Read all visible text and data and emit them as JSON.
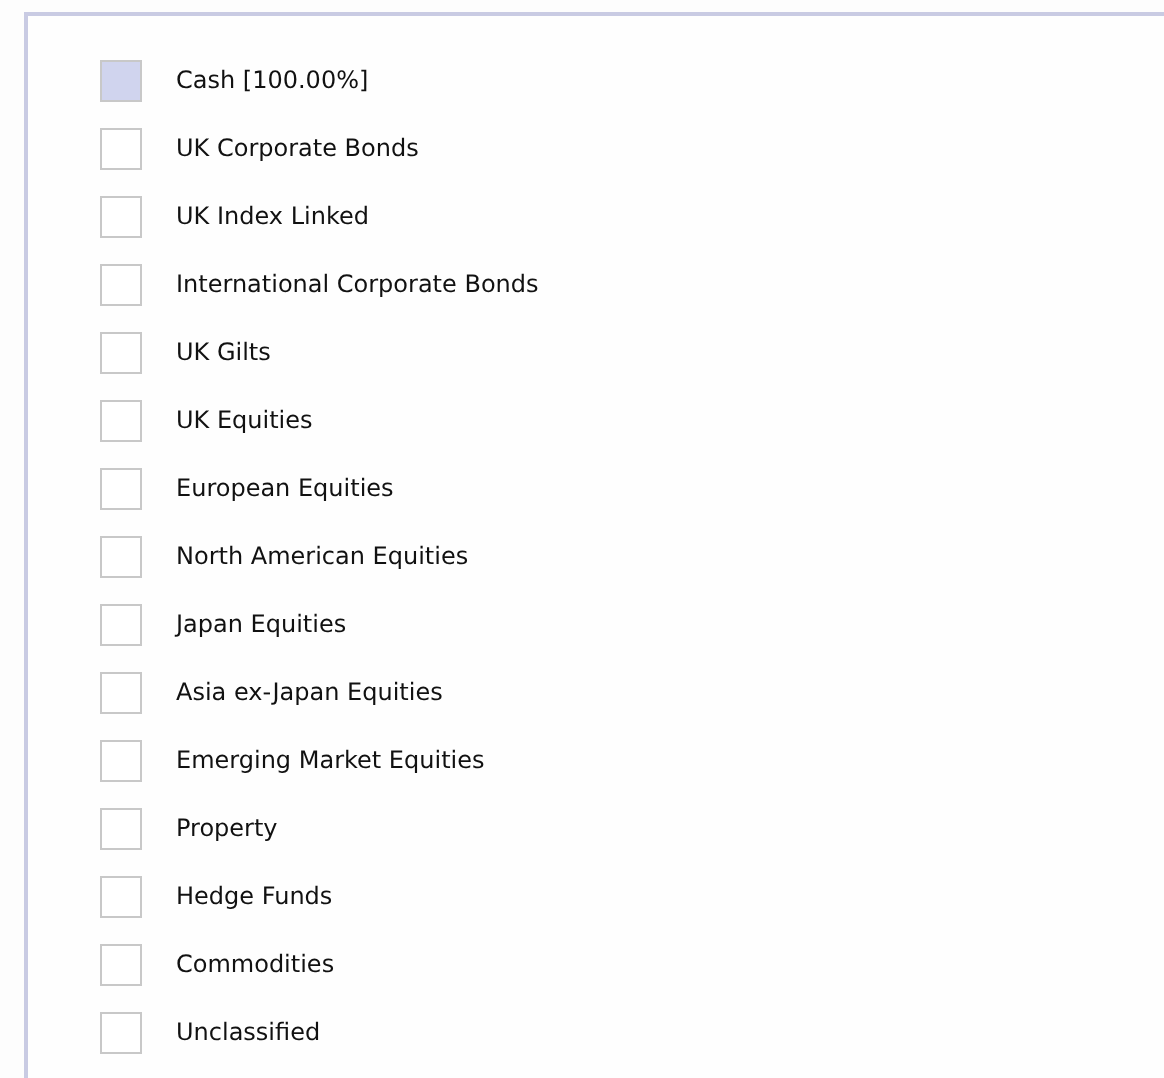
{
  "legend": {
    "items": [
      {
        "label": "Cash [100.00%]",
        "color": "#d0d4ee"
      },
      {
        "label": "UK Corporate Bonds",
        "color": "#ffffff"
      },
      {
        "label": "UK Index Linked",
        "color": "#ffffff"
      },
      {
        "label": "International Corporate Bonds",
        "color": "#ffffff"
      },
      {
        "label": "UK Gilts",
        "color": "#ffffff"
      },
      {
        "label": "UK Equities",
        "color": "#ffffff"
      },
      {
        "label": "European Equities",
        "color": "#ffffff"
      },
      {
        "label": "North American Equities",
        "color": "#ffffff"
      },
      {
        "label": "Japan Equities",
        "color": "#ffffff"
      },
      {
        "label": "Asia ex-Japan Equities",
        "color": "#ffffff"
      },
      {
        "label": "Emerging Market Equities",
        "color": "#ffffff"
      },
      {
        "label": "Property",
        "color": "#ffffff"
      },
      {
        "label": "Hedge Funds",
        "color": "#ffffff"
      },
      {
        "label": "Commodities",
        "color": "#ffffff"
      },
      {
        "label": "Unclassified",
        "color": "#ffffff"
      }
    ]
  }
}
